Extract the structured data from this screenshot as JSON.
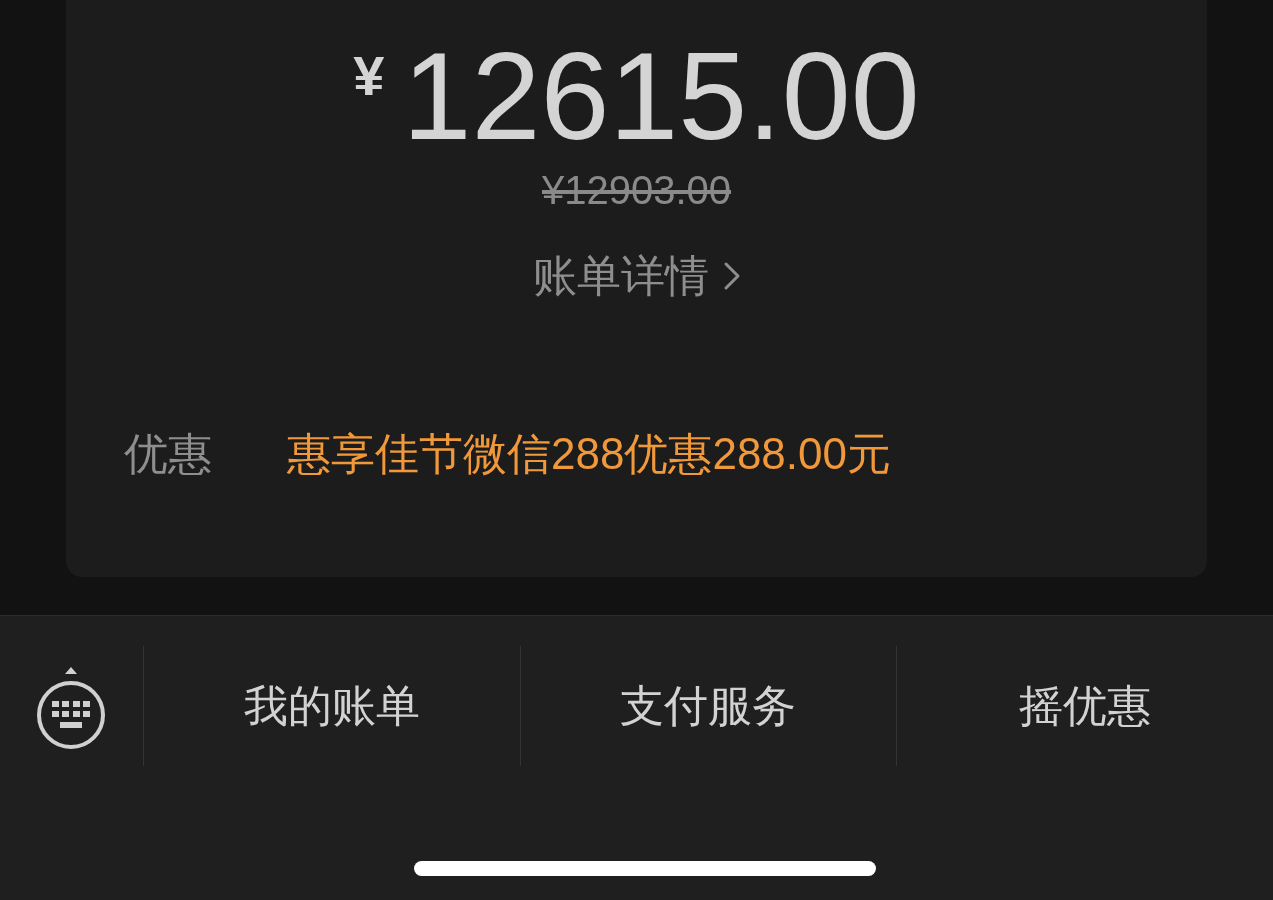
{
  "payment": {
    "currency": "¥",
    "amount": "12615.00",
    "original_price": "¥12903.00",
    "details_link": "账单详情"
  },
  "discount": {
    "label": "优惠",
    "value": "惠享佳节微信288优惠288.00元"
  },
  "bottom_menu": [
    {
      "label": "我的账单"
    },
    {
      "label": "支付服务"
    },
    {
      "label": "摇优惠"
    }
  ]
}
